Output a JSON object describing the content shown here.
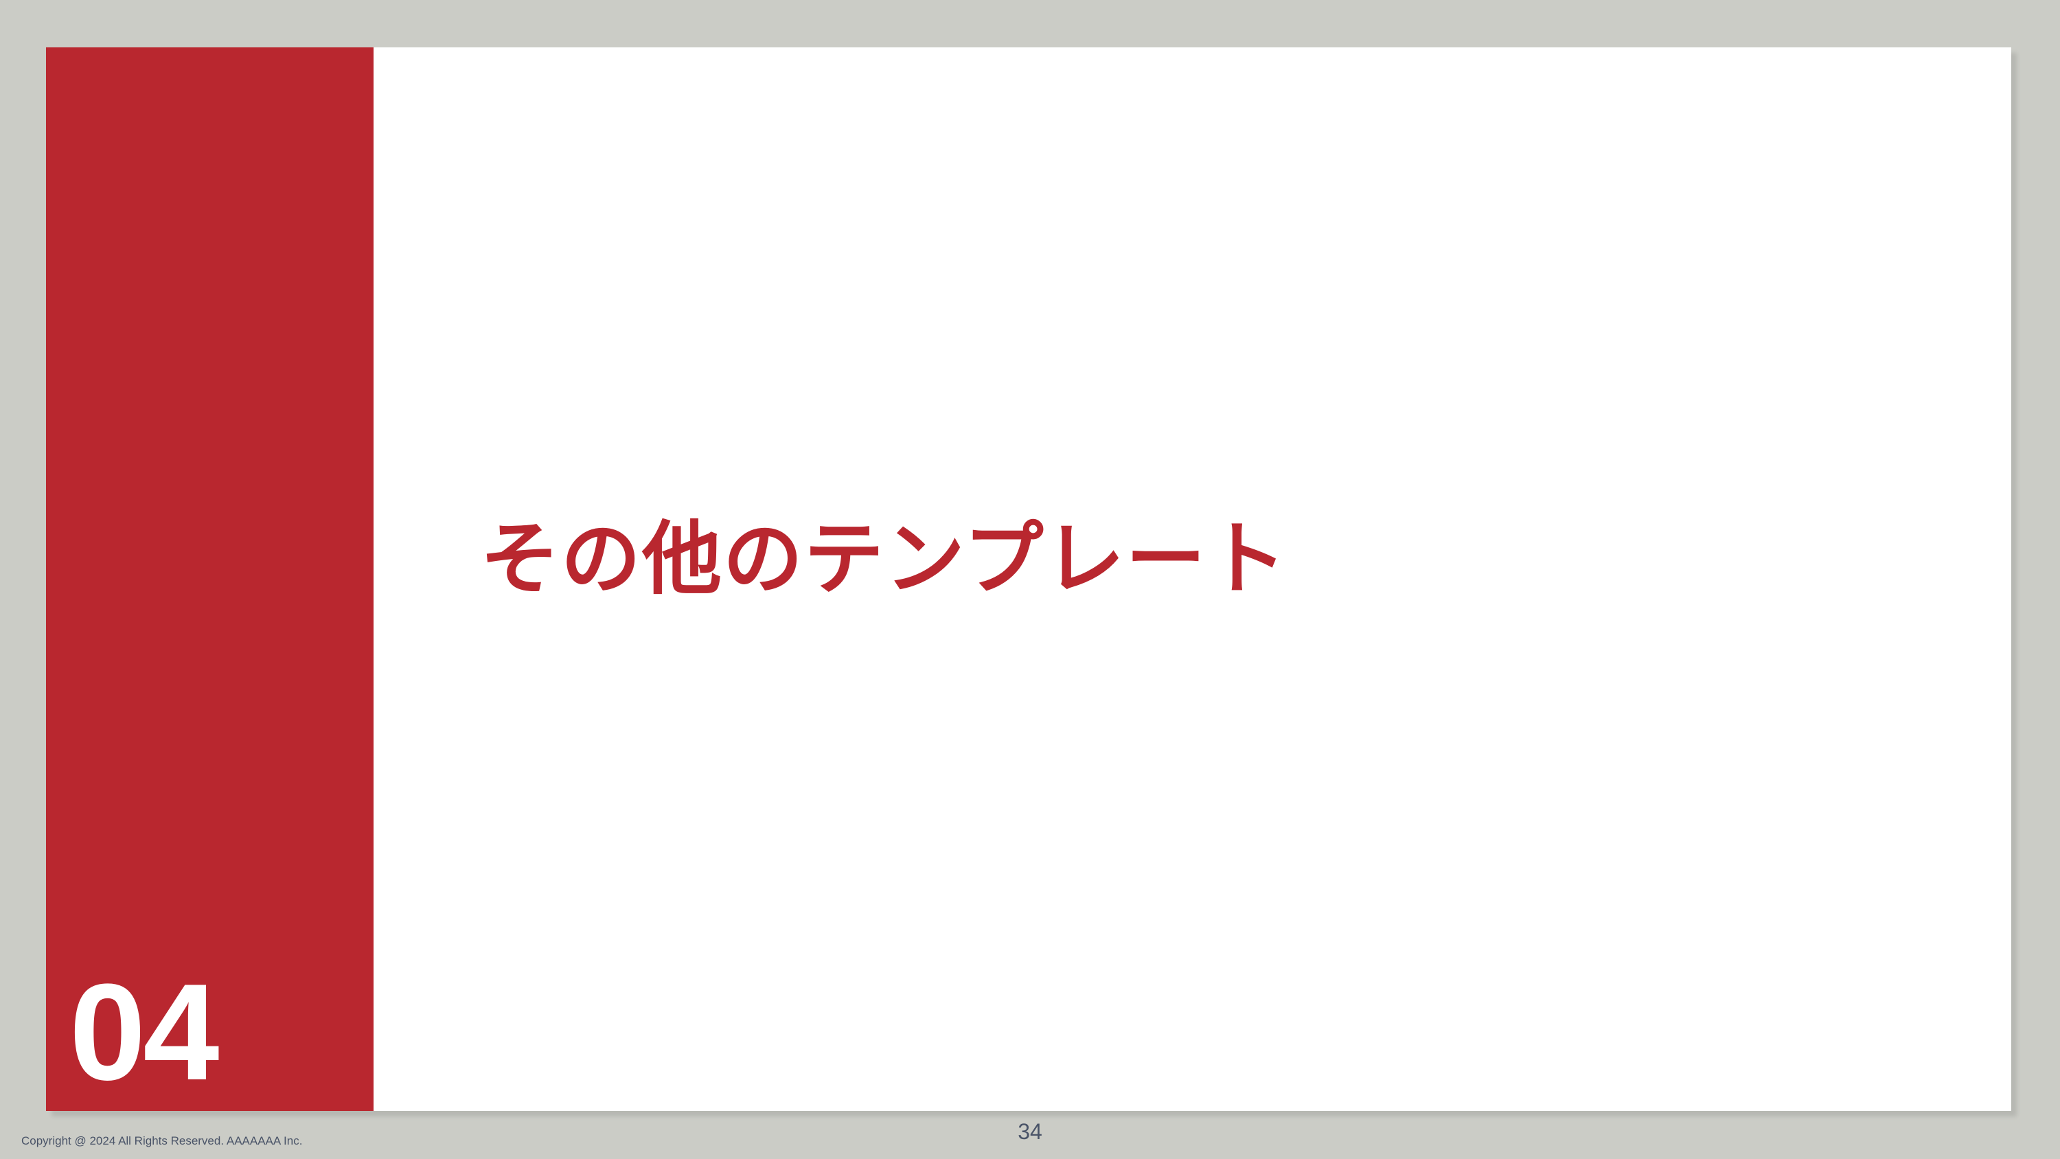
{
  "slide": {
    "section_number": "04",
    "title": "その他のテンプレート",
    "page_number": "34",
    "copyright": "Copyright @ 2024 All Rights Reserved. AAAAAAA Inc."
  },
  "colors": {
    "accent": "#b9272f",
    "background": "#cbccc6",
    "slide": "#ffffff",
    "footer_text": "#4a5468"
  }
}
